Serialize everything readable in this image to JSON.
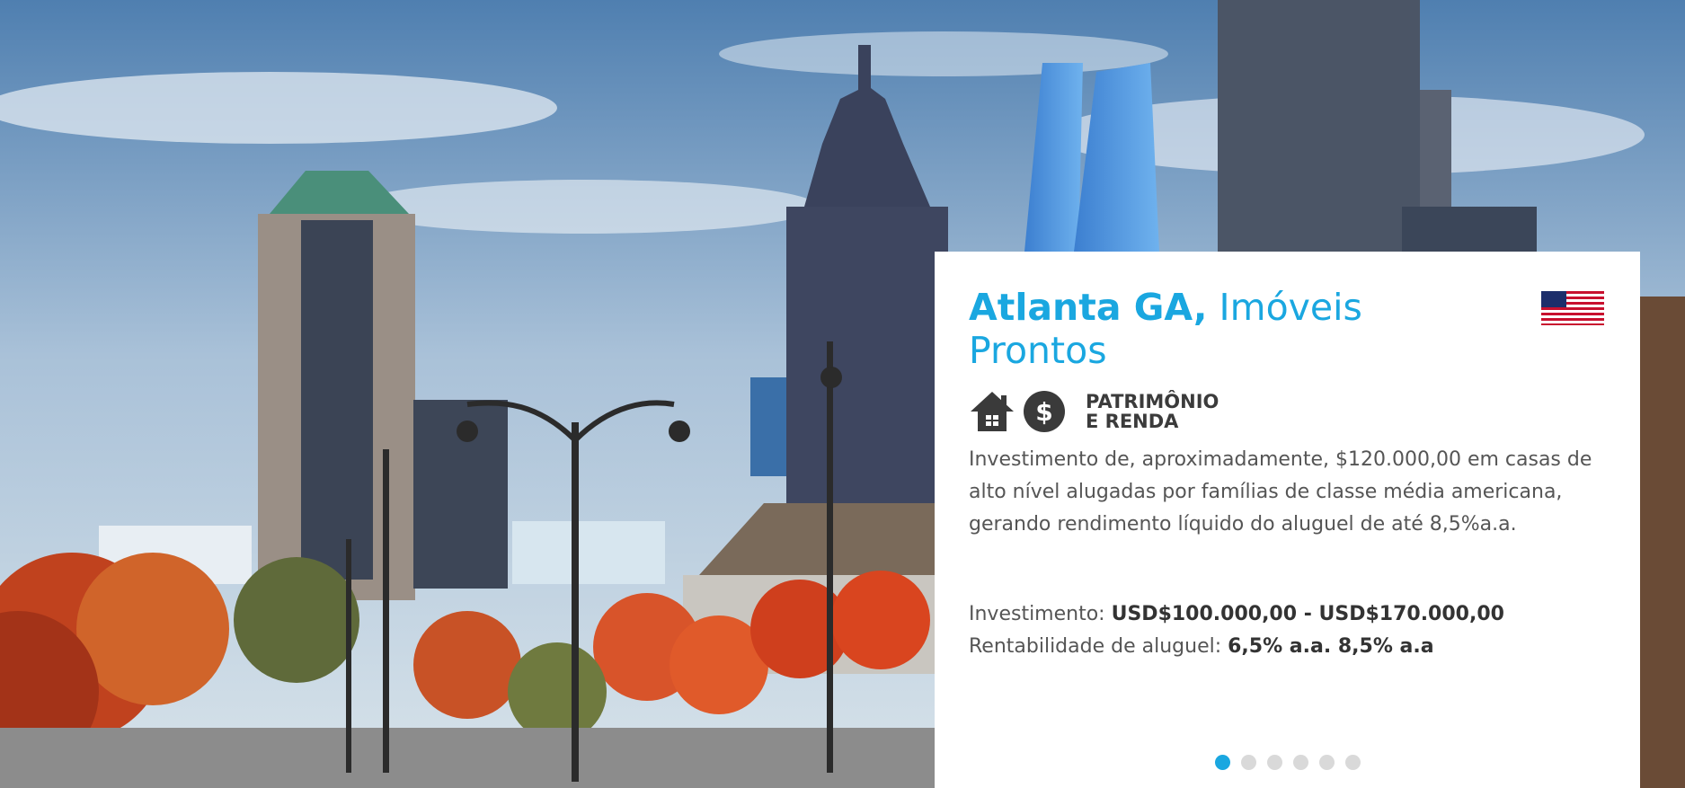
{
  "hero": {
    "image": "atlanta-city-skyline-autumn",
    "card": {
      "title_city": "Atlanta GA,",
      "title_rest": "Imóveis Prontos",
      "flag": "us-flag-icon",
      "category_icons": [
        "house-icon",
        "dollar-icon"
      ],
      "category_line1": "PATRIMÔNIO",
      "category_line2": "E RENDA",
      "description": "Investimento de, aproximadamente, $120.000,00 em casas de alto nível alugadas por famílias de classe média americana, gerando rendimento líquido do aluguel de até 8,5%a.a.",
      "investment_label": "Investimento:",
      "investment_value": "USD$100.000,00 - USD$170.000,00",
      "rent_label": "Rentabilidade de aluguel:",
      "rent_value": "6,5% a.a. 8,5% a.a"
    },
    "carousel": {
      "total_slides": 6,
      "active_slide": 1
    },
    "colors": {
      "accent": "#1aa7e0",
      "dot_inactive": "#d9d9d9"
    }
  }
}
